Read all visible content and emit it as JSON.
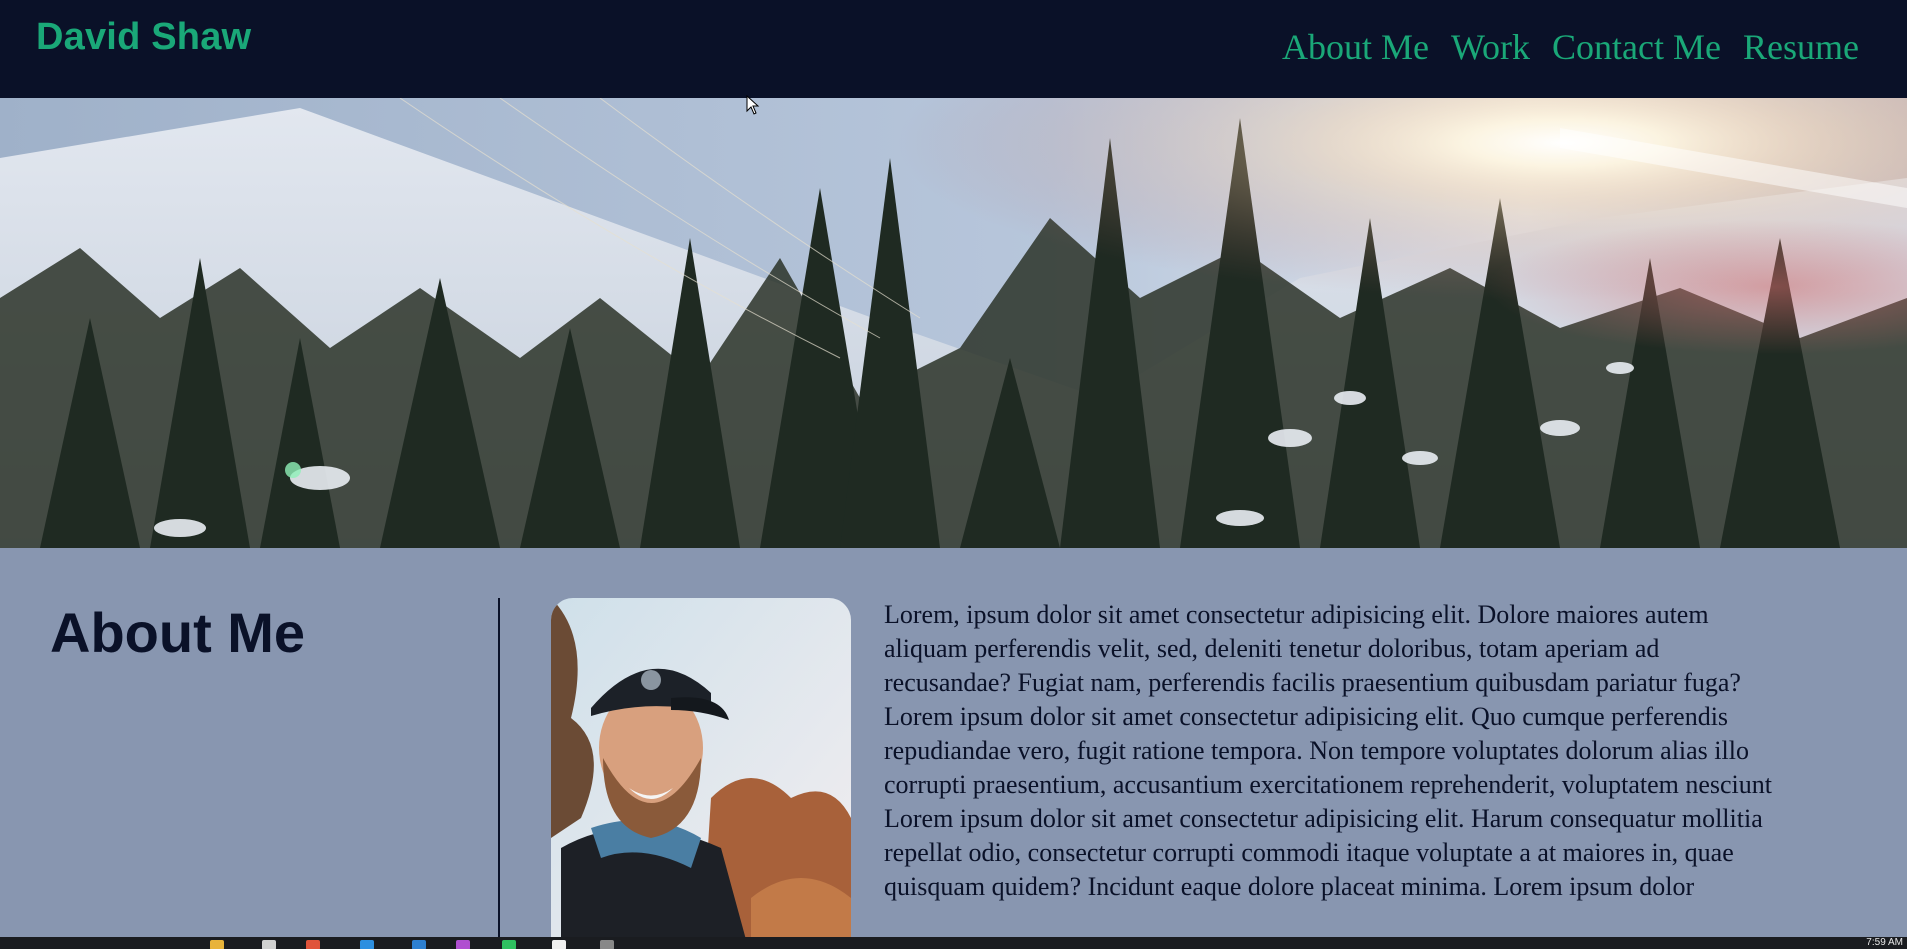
{
  "header": {
    "brand": "David Shaw",
    "nav": [
      {
        "label": "About Me"
      },
      {
        "label": "Work"
      },
      {
        "label": "Contact Me"
      },
      {
        "label": "Resume"
      }
    ]
  },
  "hero": {
    "description_icon": "mountain-forest-banner"
  },
  "about": {
    "heading": "About Me",
    "portrait_icon": "profile-photo",
    "bio": "Lorem, ipsum dolor sit amet consectetur adipisicing elit. Dolore maiores autem aliquam perferendis velit, sed, deleniti tenetur doloribus, totam aperiam ad recusandae? Fugiat nam, perferendis facilis praesentium quibusdam pariatur fuga? Lorem ipsum dolor sit amet consectetur adipisicing elit. Quo cumque perferendis repudiandae vero, fugit ratione tempora. Non tempore voluptates dolorum alias illo corrupti praesentium, accusantium exercitationem reprehenderit, voluptatem nesciunt Lorem ipsum dolor sit amet consectetur adipisicing elit. Harum consequatur mollitia repellat odio, consectetur corrupti commodi itaque voluptate a at maiores in, quae quisquam quidem? Incidunt eaque dolore placeat minima. Lorem ipsum dolor"
  },
  "taskbar": {
    "clock": "7:59 AM"
  },
  "colors": {
    "header_bg": "#0a1128",
    "accent_green": "#1aa878",
    "section_bg": "#8896b0",
    "text_dark": "#0a1128"
  }
}
